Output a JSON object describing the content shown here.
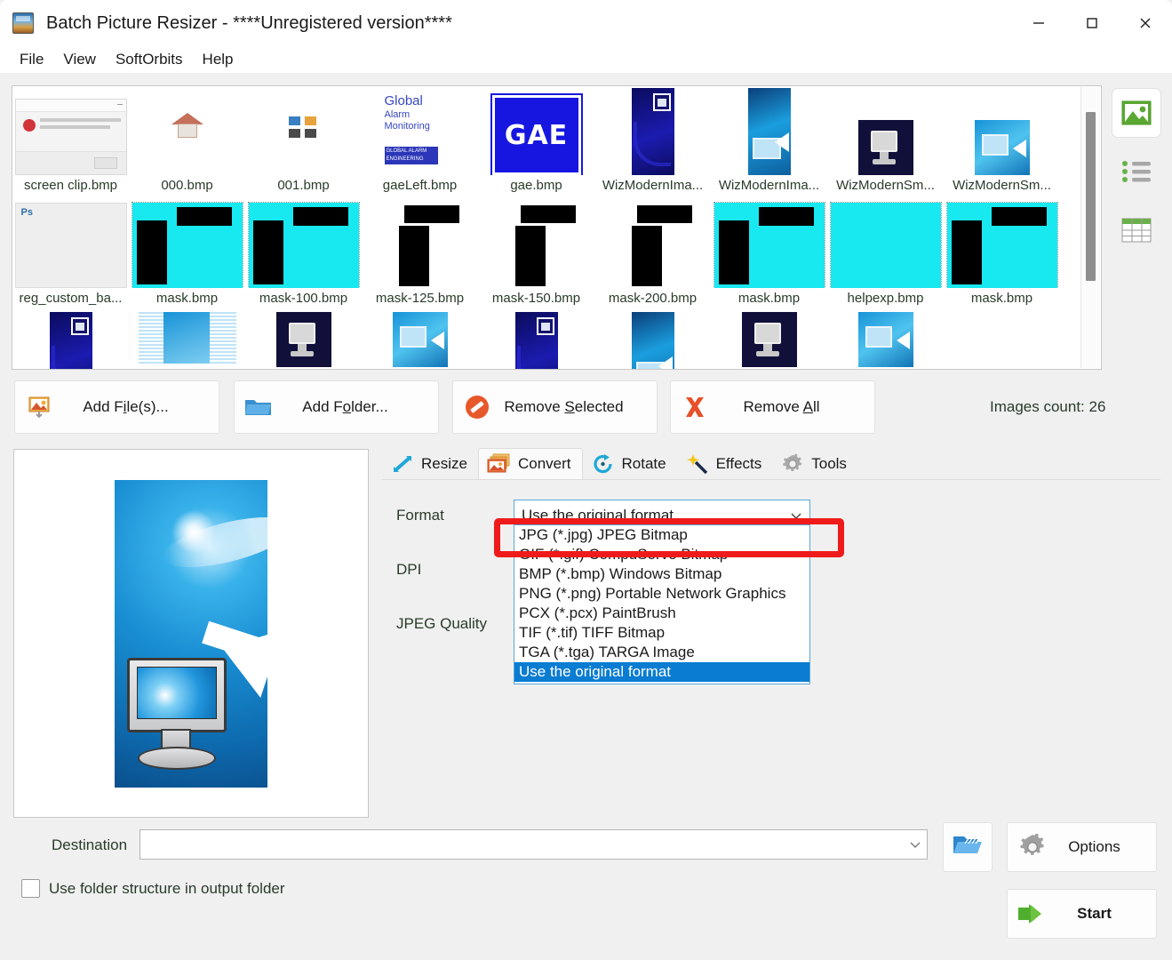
{
  "window": {
    "title": "Batch Picture Resizer - ****Unregistered version****",
    "app_icon": "app-image-icon",
    "minimize": "—",
    "maximize": "□",
    "close": "✕"
  },
  "menu": {
    "items": [
      {
        "label": "File"
      },
      {
        "label": "View"
      },
      {
        "label": "SoftOrbits"
      },
      {
        "label": "Help"
      }
    ]
  },
  "file_list": {
    "rows": [
      [
        {
          "label": "screen clip.bmp",
          "art": "screen-clip"
        },
        {
          "label": "000.bmp",
          "art": "house"
        },
        {
          "label": "001.bmp",
          "art": "grid4"
        },
        {
          "label": "gaeLeft.bmp",
          "art": "gam"
        },
        {
          "label": "gae.bmp",
          "art": "gae"
        },
        {
          "label": "WizModernIma...",
          "art": "wizmod"
        },
        {
          "label": "WizModernIma...",
          "art": "wizimg"
        },
        {
          "label": "WizModernSm...",
          "art": "wizsm"
        },
        {
          "label": "WizModernSm...",
          "art": "wizsm2"
        }
      ],
      [
        {
          "label": "reg_custom_ba...",
          "art": "psdoc"
        },
        {
          "label": "mask.bmp",
          "art": "mask-cyan"
        },
        {
          "label": "mask-100.bmp",
          "art": "mask-cyan"
        },
        {
          "label": "mask-125.bmp",
          "art": "mask-white"
        },
        {
          "label": "mask-150.bmp",
          "art": "mask-white"
        },
        {
          "label": "mask-200.bmp",
          "art": "mask-white"
        },
        {
          "label": "mask.bmp",
          "art": "mask-cyan"
        },
        {
          "label": "helpexp.bmp",
          "art": "mask-plain"
        },
        {
          "label": "mask.bmp",
          "art": "mask-cyan"
        }
      ],
      [
        {
          "label": "",
          "art": "wizmod"
        },
        {
          "label": "",
          "art": "halftone"
        },
        {
          "label": "",
          "art": "wizsm"
        },
        {
          "label": "",
          "art": "wizsm2"
        },
        {
          "label": "",
          "art": "wizmod"
        },
        {
          "label": "",
          "art": "wizimg"
        },
        {
          "label": "",
          "art": "wizsm"
        },
        {
          "label": "",
          "art": "wizsm2"
        },
        {
          "label": "",
          "art": ""
        }
      ]
    ]
  },
  "view_modes": [
    {
      "name": "thumbnail-view",
      "icon": "image-icon",
      "selected": true
    },
    {
      "name": "list-view",
      "icon": "list-icon",
      "selected": false
    },
    {
      "name": "details-view",
      "icon": "table-icon",
      "selected": false
    }
  ],
  "actions": {
    "add_files": {
      "label_pre": "Add F",
      "label_key": "i",
      "label_post": "le(s)...",
      "icon": "add-image-icon"
    },
    "add_folder": {
      "label_pre": "Add F",
      "label_key": "o",
      "label_post": "lder...",
      "icon": "folder-icon"
    },
    "remove_selected": {
      "label_pre": "Remove ",
      "label_key": "S",
      "label_post": "elected",
      "icon": "no-entry-icon"
    },
    "remove_all": {
      "label_pre": "Remove ",
      "label_key": "A",
      "label_post": "ll",
      "icon": "red-x-icon"
    },
    "images_count": "Images count: 26"
  },
  "tabs": [
    {
      "label": "Resize",
      "icon": "resize-arrows-icon",
      "active": false
    },
    {
      "label": "Convert",
      "icon": "convert-images-icon",
      "active": true
    },
    {
      "label": "Rotate",
      "icon": "rotate-icon",
      "active": false
    },
    {
      "label": "Effects",
      "icon": "magic-wand-icon",
      "active": false
    },
    {
      "label": "Tools",
      "icon": "gear-icon",
      "active": false
    }
  ],
  "convert_panel": {
    "format_label": "Format",
    "format_value": "Use the original format",
    "dpi_label": "DPI",
    "dpi_value": "",
    "jpeg_quality_label": "JPEG Quality",
    "jpeg_quality_value": "",
    "format_options": [
      {
        "label": "JPG (*.jpg) JPEG Bitmap",
        "selected": false
      },
      {
        "label": "GIF (*.gif) CompuServe Bitmap",
        "selected": false
      },
      {
        "label": "BMP (*.bmp) Windows Bitmap",
        "selected": false
      },
      {
        "label": "PNG (*.png) Portable Network Graphics",
        "selected": false
      },
      {
        "label": "PCX (*.pcx) PaintBrush",
        "selected": false
      },
      {
        "label": "TIF (*.tif) TIFF Bitmap",
        "selected": false
      },
      {
        "label": "TGA (*.tga) TARGA Image",
        "selected": false
      },
      {
        "label": "Use the original format",
        "selected": true
      }
    ],
    "highlight_color": "#ef1b1b",
    "highlight_target": "JPG (*.jpg) JPEG Bitmap"
  },
  "footer": {
    "destination_label": "Destination",
    "destination_value": "",
    "browse_icon": "open-folder-icon",
    "options_label": "Options",
    "options_icon": "gear-icon",
    "start_label": "Start",
    "start_icon": "green-arrow-icon",
    "use_folder_structure_label": "Use folder structure in output folder",
    "use_folder_structure_checked": false
  },
  "colors": {
    "accent_blue": "#0a7cd1",
    "combo_border": "#5aa6dd",
    "highlight_red": "#ef1b1b",
    "green_label": "#2a3b2a",
    "mask_cyan": "#18e8f0"
  }
}
